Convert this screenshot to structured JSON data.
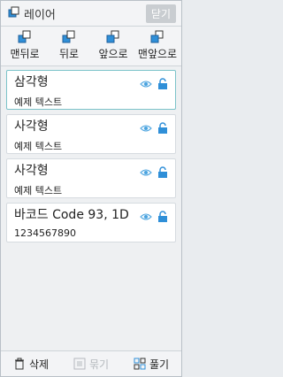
{
  "header": {
    "title": "레이어",
    "close_label": "닫기"
  },
  "toolbar": {
    "send_to_back": "맨뒤로",
    "send_backward": "뒤로",
    "bring_forward": "앞으로",
    "bring_to_front": "맨앞으로"
  },
  "layers": [
    {
      "name": "삼각형",
      "sub": "예제 텍스트",
      "selected": true
    },
    {
      "name": "사각형",
      "sub": "예제 텍스트"
    },
    {
      "name": "사각형",
      "sub": "예제 텍스트"
    },
    {
      "name": "바코드 Code 93, 1D",
      "sub": "1234567890"
    }
  ],
  "footer": {
    "delete": "삭제",
    "group": "묶기",
    "ungroup": "풀기"
  },
  "colors": {
    "accent": "#2f8fd8",
    "eye": "#4aa3df",
    "lock": "#2f8fd8"
  },
  "icons": [
    "layers-icon",
    "eye-icon",
    "unlock-icon",
    "trash-icon",
    "group-icon",
    "ungroup-icon"
  ]
}
